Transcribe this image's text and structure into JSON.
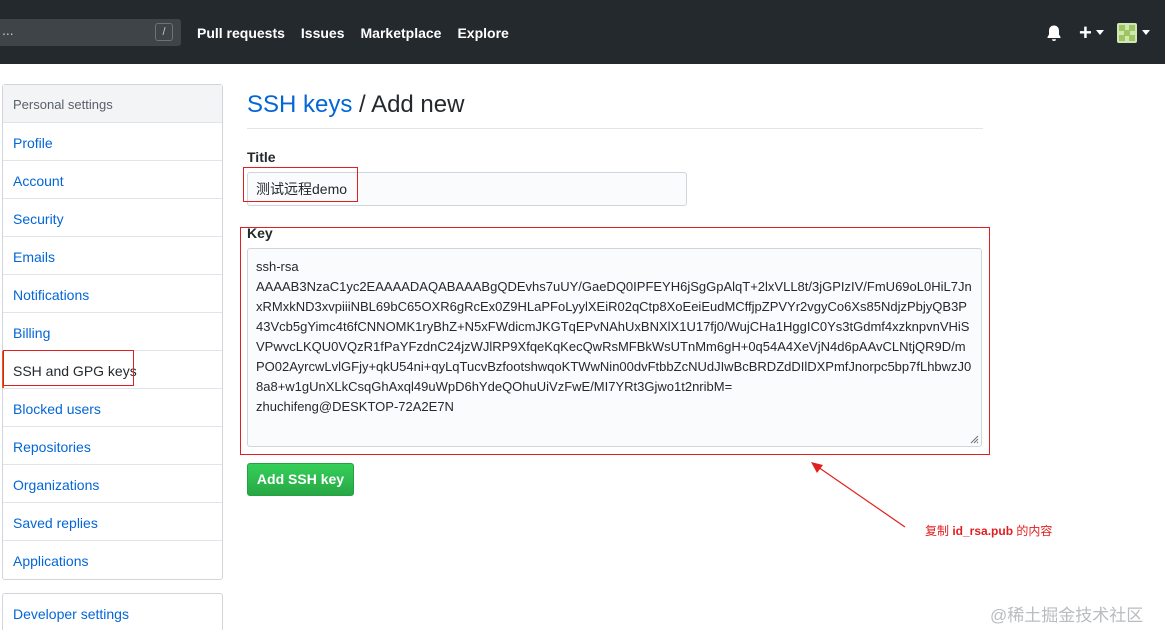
{
  "header": {
    "search_hint": "...",
    "search_shortcut": "/",
    "nav": [
      "Pull requests",
      "Issues",
      "Marketplace",
      "Explore"
    ],
    "icons": [
      "bell-icon",
      "plus-icon",
      "avatar"
    ]
  },
  "sidebar": {
    "heading": "Personal settings",
    "items": [
      {
        "label": "Profile"
      },
      {
        "label": "Account"
      },
      {
        "label": "Security"
      },
      {
        "label": "Emails"
      },
      {
        "label": "Notifications"
      },
      {
        "label": "Billing"
      },
      {
        "label": "SSH and GPG keys",
        "selected": true
      },
      {
        "label": "Blocked users"
      },
      {
        "label": "Repositories"
      },
      {
        "label": "Organizations"
      },
      {
        "label": "Saved replies"
      },
      {
        "label": "Applications"
      }
    ],
    "developer_settings": "Developer settings"
  },
  "main": {
    "breadcrumb": "SSH keys",
    "separator": " / ",
    "title": "Add new",
    "title_label": "Title",
    "title_value": "测试远程demo",
    "key_label": "Key",
    "key_value": "ssh-rsa\nAAAAB3NzaC1yc2EAAAADAQABAAABgQDEvhs7uUY/GaeDQ0IPFEYH6jSgGpAlqT+2lxVLL8t/3jGPIzIV/FmU69oL0HiL7JnxRMxkND3xvpiiiNBL69bC65OXR6gRcEx0Z9HLaPFoLyylXEiR02qCtp8XoEeiEudMCffjpZPVYr2vgyCo6Xs85NdjzPbjyQB3P43Vcb5gYimc4t6fCNNOMK1ryBhZ+N5xFWdicmJKGTqEPvNAhUxBNXlX1U17fj0/WujCHa1HggIC0Ys3tGdmf4xzknpvnVHiSVPwvcLKQU0VQzR1fPaYFzdnC24jzWJlRP9XfqeKqKecQwRsMFBkWsUTnMm6gH+0q54A4XeVjN4d6pAAvCLNtjQR9D/mPO02AyrcwLvlGFjy+qkU54ni+qyLqTucvBzfootshwqoKTWwNin00dvFtbbZcNUdJIwBcBRDZdDIlDXPmfJnorpc5bp7fLhbwzJ08a8+w1gUnXLkCsqGhAxql49uWpD6hYdeQOhuUiVzFwE/MI7YRt3Gjwo1t2nribM=\nzhuchifeng@DESKTOP-72A2E7N",
    "add_button": "Add SSH key"
  },
  "annotation": {
    "prefix": "复制 ",
    "file": "id_rsa.pub",
    "suffix": " 的内容"
  },
  "watermark": "@稀土掘金技术社区",
  "colors": {
    "header_bg": "#24292e",
    "link": "#0366d6",
    "button_green": "#28a745",
    "annotation_red": "#e02020"
  }
}
